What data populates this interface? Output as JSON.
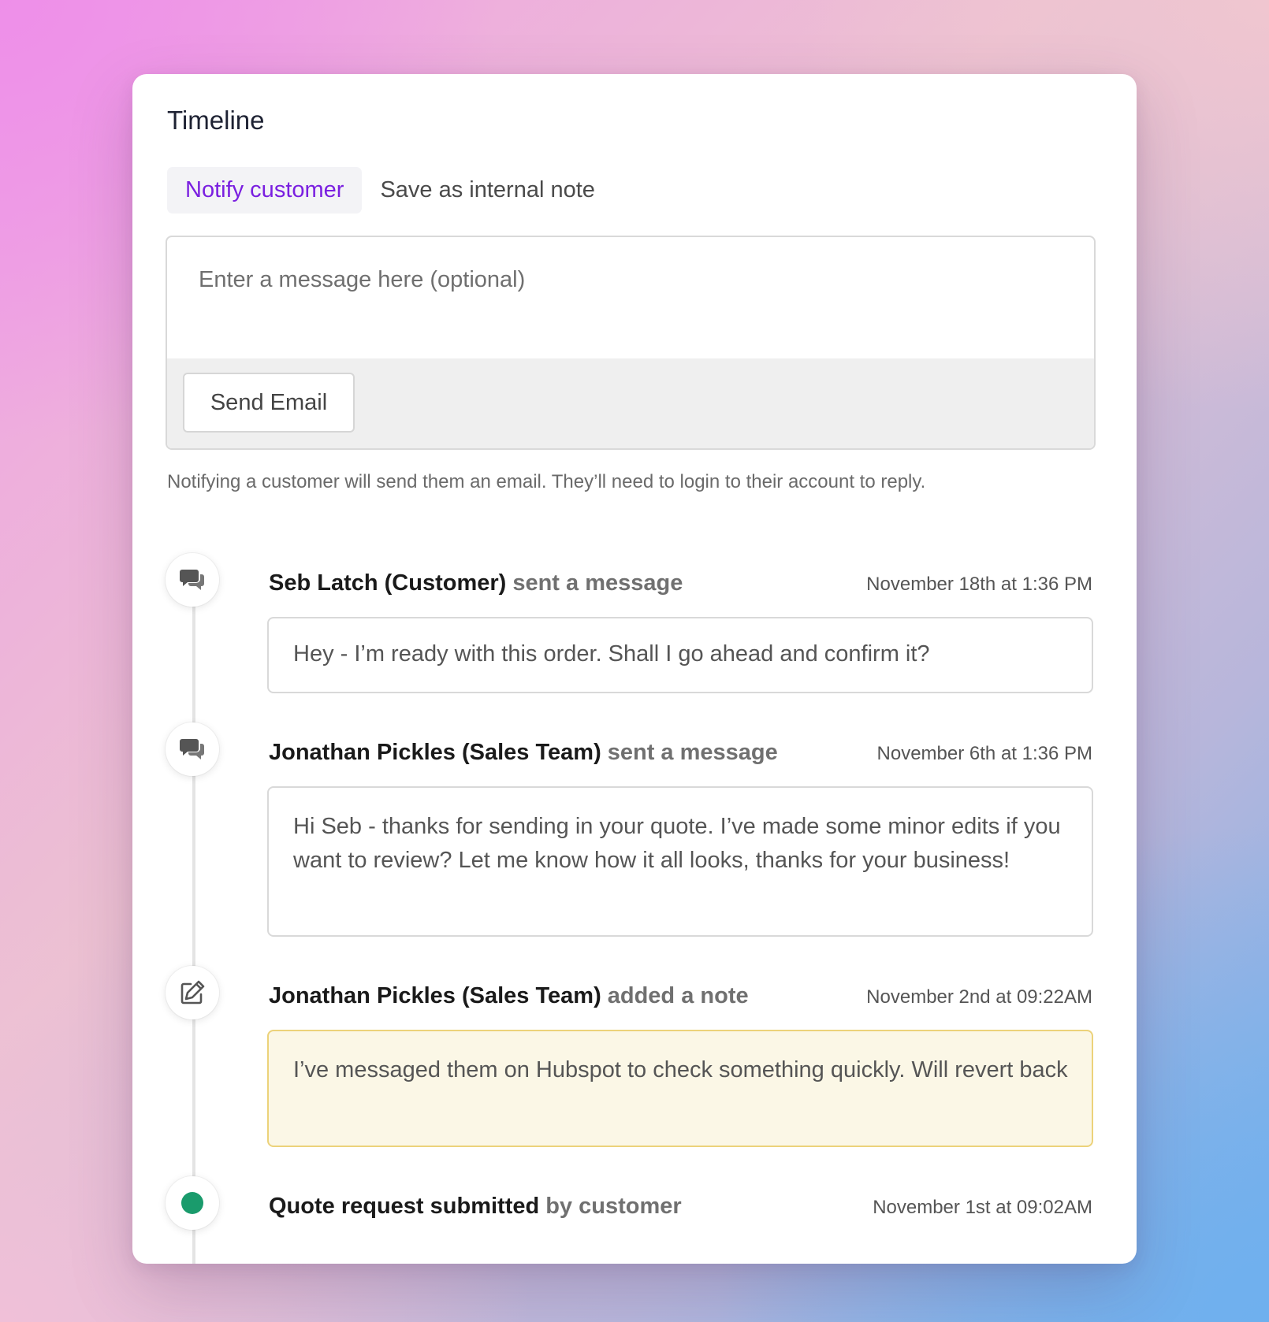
{
  "page": {
    "title": "Timeline"
  },
  "tabs": [
    {
      "label": "Notify customer",
      "active": true
    },
    {
      "label": "Save as internal note",
      "active": false
    }
  ],
  "composer": {
    "placeholder": "Enter a message here (optional)",
    "value": "",
    "send_label": "Send Email"
  },
  "hint": "Notifying a customer will send them an email. They’ll need to login to their account to reply.",
  "colors": {
    "accent": "#7a1fe0",
    "note_bg": "#fbf7e6",
    "note_border": "#ecd27a",
    "status_dot": "#1a9b6c"
  },
  "events": [
    {
      "icon": "chat-bubbles-icon",
      "actor": "Seb Latch (Customer)",
      "action": "sent a message",
      "time": "November 18th at 1:36 PM",
      "message": "Hey - I’m ready with this order. Shall I go ahead and confirm it?"
    },
    {
      "icon": "chat-bubbles-icon",
      "actor": "Jonathan Pickles (Sales Team)",
      "action": "sent a message",
      "time": "November 6th at 1:36 PM",
      "message": "Hi Seb - thanks for sending in your quote. I’ve made some minor edits if you want to review? Let me know how it all looks, thanks for your business!"
    },
    {
      "icon": "edit-note-icon",
      "actor": "Jonathan Pickles (Sales Team)",
      "action": "added a note",
      "time": "November 2nd at 09:22AM",
      "message": "I’ve messaged them on Hubspot to check something quickly. Will revert back"
    },
    {
      "icon": "status-dot-icon",
      "actor": "Quote request submitted",
      "action": "by customer",
      "time": "November 1st at 09:02AM"
    }
  ]
}
